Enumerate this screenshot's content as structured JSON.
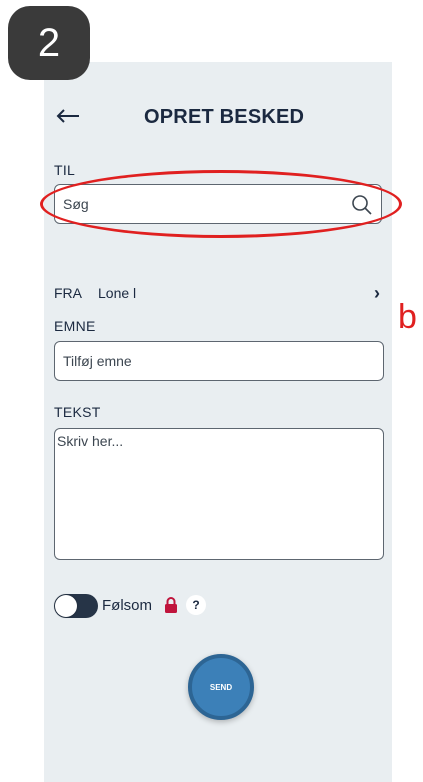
{
  "step_badge": "2",
  "header": {
    "title": "OPRET BESKED",
    "back_icon": "arrow-left-icon"
  },
  "to": {
    "label": "TIL",
    "placeholder": "Søg",
    "icon": "search-icon"
  },
  "from": {
    "label": "FRA",
    "value": "Lone l",
    "chevron": "›"
  },
  "subject": {
    "label": "EMNE",
    "placeholder": "Tilføj emne"
  },
  "text": {
    "label": "TEKST",
    "placeholder": "Skriv her..."
  },
  "sensitive": {
    "label": "Følsom",
    "help": "?",
    "lock_icon": "lock-icon",
    "on": false
  },
  "send": {
    "label": "SEND"
  },
  "annotation": {
    "letter": "b",
    "color": "#e02020"
  },
  "colors": {
    "background": "#e9eef1",
    "text": "#1b2940",
    "send": "#3c80b8",
    "lock": "#c0143c"
  }
}
